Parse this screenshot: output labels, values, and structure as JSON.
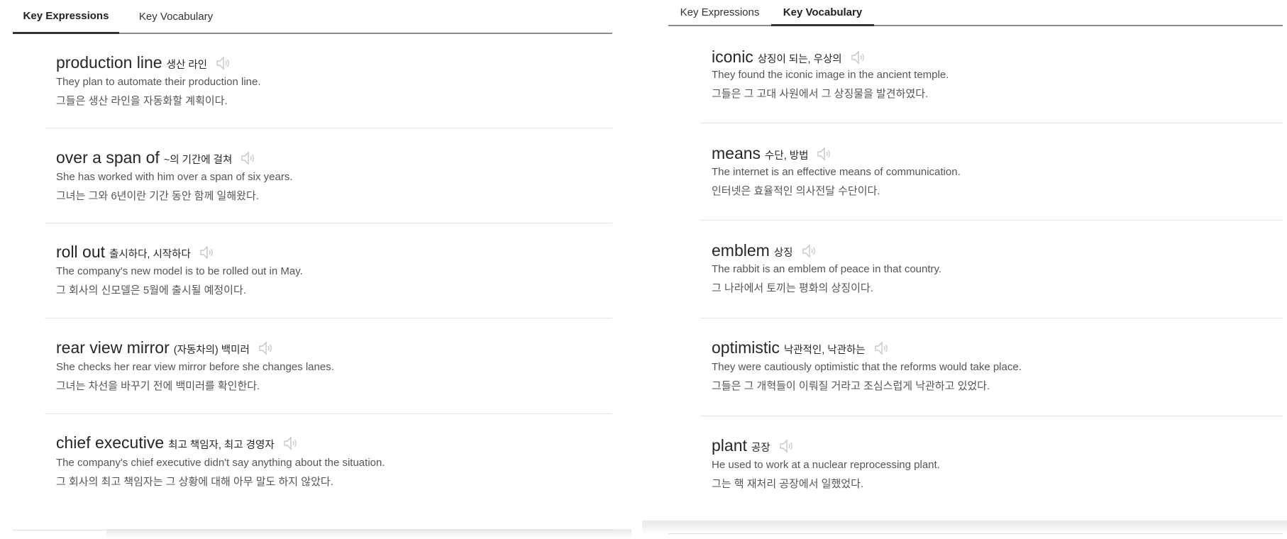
{
  "panels": [
    {
      "tabs": [
        {
          "label": "Key Expressions",
          "active": true
        },
        {
          "label": "Key Vocabulary",
          "active": false
        }
      ],
      "entries": [
        {
          "term": "production line",
          "meaning": "생산 라인",
          "example": "They plan to automate their production line.",
          "translation": "그들은 생산 라인을 자동화할 계획이다."
        },
        {
          "term": "over a span of",
          "meaning": "~의 기간에 걸쳐",
          "example": "She has worked with him over a span of six years.",
          "translation": "그녀는 그와 6년이란 기간 동안 함께 일해왔다."
        },
        {
          "term": "roll out",
          "meaning": "출시하다, 시작하다",
          "example": "The company's new model is to be rolled out in May.",
          "translation": "그 회사의 신모델은 5월에 출시될 예정이다."
        },
        {
          "term": "rear view mirror",
          "meaning": "(자동차의) 백미러",
          "example": "She checks her rear view mirror before she changes lanes.",
          "translation": "그녀는 차선을 바꾸기 전에 백미러를 확인한다."
        },
        {
          "term": "chief executive",
          "meaning": "최고 책임자, 최고 경영자",
          "example": "The company's chief executive didn't say anything about the situation.",
          "translation": "그 회사의 최고 책임자는 그 상황에 대해 아무 말도 하지 않았다."
        }
      ]
    },
    {
      "tabs": [
        {
          "label": "Key Expressions",
          "active": false
        },
        {
          "label": "Key Vocabulary",
          "active": true
        }
      ],
      "entries": [
        {
          "term": "iconic",
          "meaning": "상징이 되는, 우상의",
          "example": "They found the iconic image in the ancient temple.",
          "translation": "그들은 그 고대 사원에서 그 상징물을 발견하였다."
        },
        {
          "term": "means",
          "meaning": "수단, 방법",
          "example": "The internet is an effective means of communication.",
          "translation": "인터넷은 효율적인 의사전달 수단이다."
        },
        {
          "term": "emblem",
          "meaning": "상징",
          "example": "The rabbit is an emblem of peace in that country.",
          "translation": "그 나라에서 토끼는 평화의 상징이다."
        },
        {
          "term": "optimistic",
          "meaning": "낙관적인, 낙관하는",
          "example": "They were cautiously optimistic that the reforms would take place.",
          "translation": "그들은 그 개혁들이 이뤄질 거라고 조심스럽게 낙관하고 있었다."
        },
        {
          "term": "plant",
          "meaning": "공장",
          "example": "He used to work at a nuclear reprocessing plant.",
          "translation": "그는 핵 재처리 공장에서 일했었다."
        }
      ]
    }
  ],
  "icons": {
    "speaker": "speaker-volume-icon",
    "speaker_color": "#c8c8c8"
  },
  "colors": {
    "tab_underline": "#333333",
    "rule": "#8c8c8c",
    "divider": "#e4e4e4"
  }
}
